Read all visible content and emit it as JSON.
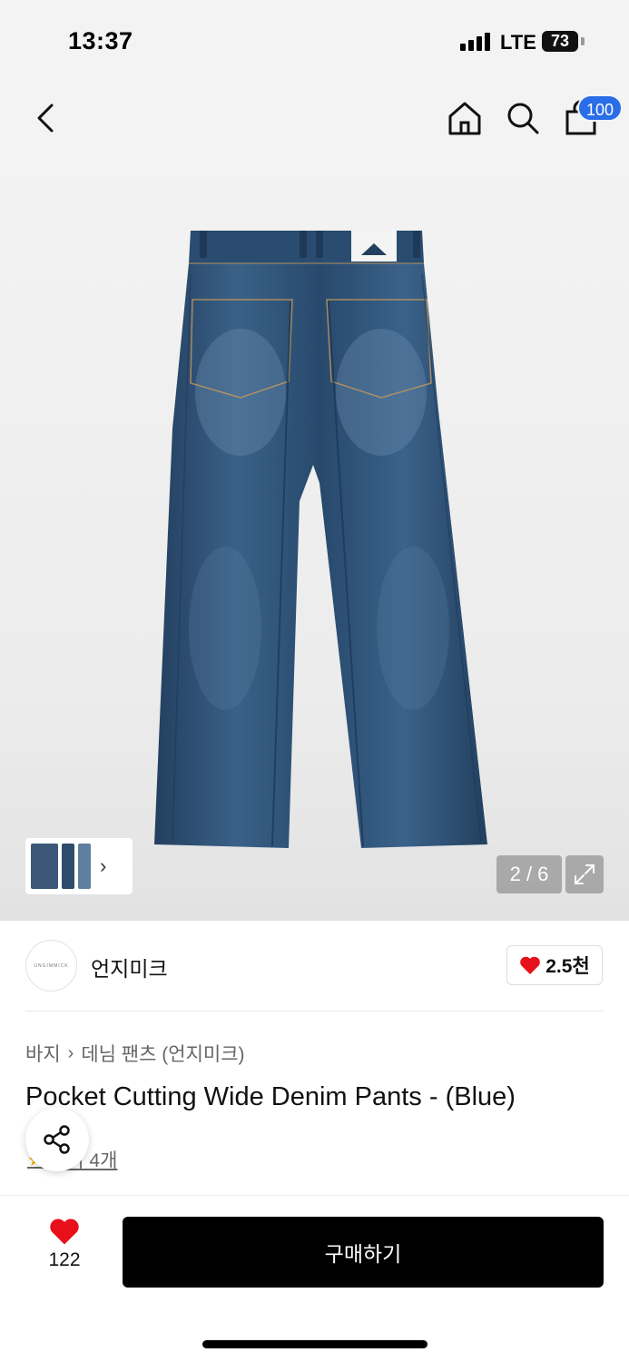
{
  "status_bar": {
    "time": "13:37",
    "network": "LTE",
    "battery": "73"
  },
  "nav": {
    "cart_count": "100"
  },
  "gallery": {
    "counter": "2 / 6"
  },
  "brand": {
    "name": "언지미크",
    "logo_text": "UNGIMMICK",
    "likes": "2.5천"
  },
  "product": {
    "breadcrumb": [
      "바지",
      "데님 팬츠 (언지미크)"
    ],
    "title": "Pocket Cutting Wide Denim Pants - (Blue)",
    "reviews": "후기 4개"
  },
  "bottom": {
    "wish_count": "122",
    "buy_label": "구매하기"
  },
  "colors": {
    "badge": "#2a6de8",
    "heart": "#e8101a",
    "denim": "#2f5479",
    "buy_button": "#000000"
  }
}
